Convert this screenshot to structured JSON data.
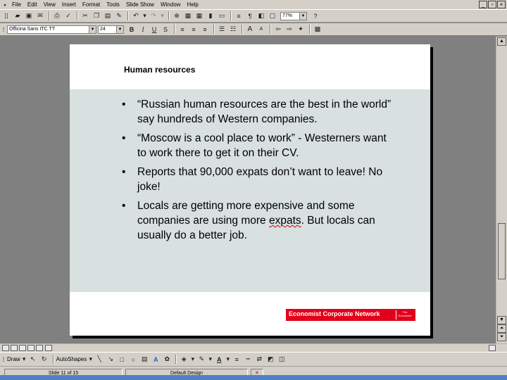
{
  "menubar": {
    "items": [
      "File",
      "Edit",
      "View",
      "Insert",
      "Format",
      "Tools",
      "Slide Show",
      "Window",
      "Help"
    ]
  },
  "toolbar_standard": {
    "zoom": "77%"
  },
  "toolbar_formatting": {
    "font_name": "Officina Sans ITC TT",
    "font_size": "24",
    "bold": "B",
    "italic": "I",
    "underline": "U",
    "shadow": "S",
    "bigger_font": "A",
    "smaller_font": "A"
  },
  "slide": {
    "title": "Human resources",
    "bullets": [
      {
        "pre": "“Russian human resources are the best in the world” say hundreds of Western companies.",
        "flag": "",
        "post": ""
      },
      {
        "pre": "“Moscow is a cool place to work” - Westerners want to work there to get it on their CV.",
        "flag": "",
        "post": ""
      },
      {
        "pre": "Reports that 90,000 expats don’t want to leave! No joke!",
        "flag": "",
        "post": ""
      },
      {
        "pre": "Locals are getting more expensive and some companies are using more ",
        "flag": "expats",
        "post": ". But locals can usually do a better job."
      }
    ],
    "logo_text": "Economist Corporate Network",
    "logo_seal": "The Economist"
  },
  "drawbar": {
    "draw_label": "Draw",
    "autoshapes_label": "AutoShapes"
  },
  "statusbar": {
    "slide_position": "Slide 11 of 15",
    "design": "Default Design"
  },
  "colors": {
    "slide_band": "#d8e0e0",
    "logo_red": "#e2001a",
    "app_gray": "#d4d0c8"
  }
}
